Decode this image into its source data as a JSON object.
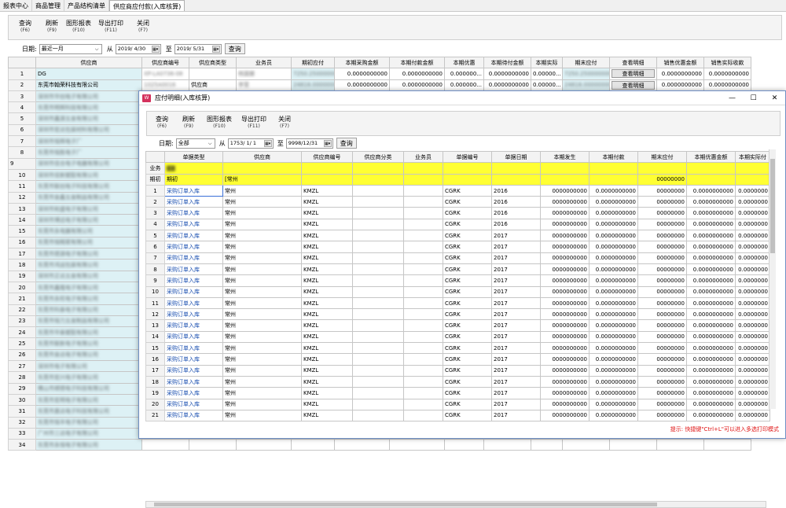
{
  "tabs": [
    "报表中心",
    "商品管理",
    "产品结构清单",
    "供应商应付款(入库核算)"
  ],
  "toolbar": [
    {
      "label": "查询",
      "key": "(F6)"
    },
    {
      "label": "刷新",
      "key": "(F9)"
    },
    {
      "label": "图形报表",
      "key": "(F10)"
    },
    {
      "label": "导出打印",
      "key": "(F11)"
    },
    {
      "label": "关闭",
      "key": "(F7)"
    }
  ],
  "filter": {
    "date_label": "日期:",
    "range_value": "最近一月",
    "from_label": "从",
    "from_date": "2019/ 4/30",
    "to_label": "至",
    "to_date": "2019/ 5/31",
    "query": "查询"
  },
  "main_grid": {
    "columns": [
      "供应商",
      "供应商编号",
      "供应商类型",
      "业务员",
      "期初应付",
      "本期采购金额",
      "本期付款金额",
      "本期优惠",
      "本期待付金额",
      "本期实际",
      "期末应付",
      "查看明细",
      "销售优惠金额",
      "销售实际收款"
    ],
    "detail_btn": "查看明细",
    "rows": [
      {
        "n": "1",
        "supplier": "DG",
        "code": "XP-LA0736-08",
        "type": "",
        "staff": "杨国娜",
        "open": "7250.2500000000",
        "purchase": "0.0000000000",
        "paid": "0.0000000000",
        "disc": "0.000000...",
        "due": "0.0000000000",
        "actual": "0.00000...",
        "close": "7250.2500000000",
        "sdisc": "0.0000000000",
        "srecv": "0.0000000000"
      },
      {
        "n": "2",
        "supplier": "东莞市翰荣科技有限公司",
        "code": "1025A0016",
        "type": "供应商",
        "staff": "李莹",
        "open": "24816.0000000000",
        "purchase": "0.0000000000",
        "paid": "0.0000000000",
        "disc": "0.000000...",
        "due": "0.0000000000",
        "actual": "0.00000...",
        "close": "24816.0000000000",
        "sdisc": "0.0000000000",
        "srecv": "0.0000000000"
      },
      {
        "n": "3",
        "supplier": "深圳市华创电子有限公司"
      },
      {
        "n": "4",
        "supplier": "东莞市明辉科技有限公司"
      },
      {
        "n": "5",
        "supplier": "深圳市鑫源五金有限公司"
      },
      {
        "n": "6",
        "supplier": "深圳市宏达包装材料有限公司"
      },
      {
        "n": "7",
        "supplier": "深圳市恒辉电子厂"
      },
      {
        "n": "8",
        "supplier": "东莞市恒胜电子厂"
      },
      {
        "n": "9",
        "supplier": "深圳市佳合电子电器有限公司"
      },
      {
        "n": "10",
        "supplier": "深圳市佳新塑胶有限公司"
      },
      {
        "n": "11",
        "supplier": "东莞市联创电子科技有限公司"
      },
      {
        "n": "12",
        "supplier": "东莞市金鑫五金制品有限公司"
      },
      {
        "n": "13",
        "supplier": "深圳市和盛电子有限公司"
      },
      {
        "n": "14",
        "supplier": "深圳市博远电子有限公司"
      },
      {
        "n": "15",
        "supplier": "东莞市永电器有限公司"
      },
      {
        "n": "16",
        "supplier": "东莞市恒精密有限公司"
      },
      {
        "n": "17",
        "supplier": "东莞市德源电子有限公司"
      },
      {
        "n": "18",
        "supplier": "东莞市鸿运包装有限公司"
      },
      {
        "n": "19",
        "supplier": "深圳市正达五金有限公司"
      },
      {
        "n": "20",
        "supplier": "东莞市鑫隆电子有限公司"
      },
      {
        "n": "21",
        "supplier": "东莞市永旺电子有限公司"
      },
      {
        "n": "22",
        "supplier": "东莞市科泰电子有限公司"
      },
      {
        "n": "23",
        "supplier": "东莞市恒力五金制品有限公司"
      },
      {
        "n": "24",
        "supplier": "东莞市华泰塑胶有限公司"
      },
      {
        "n": "25",
        "supplier": "东莞市联新电子有限公司"
      },
      {
        "n": "26",
        "supplier": "东莞市金达电子有限公司"
      },
      {
        "n": "27",
        "supplier": "深圳市电子有限公司"
      },
      {
        "n": "28",
        "supplier": "东莞市宏兴电子有限公司"
      },
      {
        "n": "29",
        "supplier": "佛山市顺德电子科技有限公司"
      },
      {
        "n": "30",
        "supplier": "东莞市宏明电子有限公司"
      },
      {
        "n": "31",
        "supplier": "东莞市嘉达电子科技有限公司"
      },
      {
        "n": "32",
        "supplier": "东莞市恒丰电子有限公司"
      },
      {
        "n": "33",
        "supplier": "广州市三达电子有限公司"
      },
      {
        "n": "34",
        "supplier": "东莞市永恒电子有限公司"
      }
    ]
  },
  "dialog": {
    "title": "应付明细(入库核算)",
    "window_controls": [
      "—",
      "☐",
      "✕"
    ],
    "toolbar": [
      {
        "label": "查询",
        "key": "(F6)"
      },
      {
        "label": "刷新",
        "key": "(F9)"
      },
      {
        "label": "图形报表",
        "key": "(F10)"
      },
      {
        "label": "导出打印",
        "key": "(F11)"
      },
      {
        "label": "关闭",
        "key": "(F7)"
      }
    ],
    "filter": {
      "date_label": "日期:",
      "range_value": "全部",
      "from_label": "从",
      "from_date": "1753/ 1/ 1",
      "to_label": "至",
      "to_date": "9998/12/31",
      "query": "查询"
    },
    "columns": [
      "单据类型",
      "供应商",
      "供应商编号",
      "供应商分类",
      "业务员",
      "单据编号",
      "单据日期",
      "本期发生",
      "本期付款",
      "期末应付",
      "本期优惠金额",
      "本期实际付"
    ],
    "summary": {
      "row1_label": "业务",
      "row2_label": "期初",
      "row2_type": "期初",
      "row2_supplier": "[常州",
      "row2_close": "00000000"
    },
    "rows": [
      {
        "n": "1",
        "type": "采购订单入库",
        "supplier": "常州",
        "code": "KMZL",
        "bill": "CGRK",
        "date": "2016",
        "amount": "0000000000",
        "paid": "0.0000000000",
        "close": "00000000",
        "disc": "0.0000000000",
        "actual": "0.0000000"
      },
      {
        "n": "2",
        "type": "采购订单入库",
        "supplier": "常州",
        "code": "KMZL",
        "bill": "CGRK",
        "date": "2016",
        "amount": "0000000000",
        "paid": "0.0000000000",
        "close": "00000000",
        "disc": "0.0000000000",
        "actual": "0.0000000"
      },
      {
        "n": "3",
        "type": "采购订单入库",
        "supplier": "常州",
        "code": "KMZL",
        "bill": "CGRK",
        "date": "2016",
        "amount": "0000000000",
        "paid": "0.0000000000",
        "close": "00000000",
        "disc": "0.0000000000",
        "actual": "0.0000000"
      },
      {
        "n": "4",
        "type": "采购订单入库",
        "supplier": "常州",
        "code": "KMZL",
        "bill": "CGRK",
        "date": "2016",
        "amount": "0000000000",
        "paid": "0.0000000000",
        "close": "00000000",
        "disc": "0.0000000000",
        "actual": "0.0000000"
      },
      {
        "n": "5",
        "type": "采购订单入库",
        "supplier": "常州",
        "code": "KMZL",
        "bill": "CGRK",
        "date": "2017",
        "amount": "0000000000",
        "paid": "0.0000000000",
        "close": "00000000",
        "disc": "0.0000000000",
        "actual": "0.0000000"
      },
      {
        "n": "6",
        "type": "采购订单入库",
        "supplier": "常州",
        "code": "KMZL",
        "bill": "CGRK",
        "date": "2017",
        "amount": "0000000000",
        "paid": "0.0000000000",
        "close": "00000000",
        "disc": "0.0000000000",
        "actual": "0.0000000"
      },
      {
        "n": "7",
        "type": "采购订单入库",
        "supplier": "常州",
        "code": "KMZL",
        "bill": "CGRK",
        "date": "2017",
        "amount": "0000000000",
        "paid": "0.0000000000",
        "close": "00000000",
        "disc": "0.0000000000",
        "actual": "0.0000000"
      },
      {
        "n": "8",
        "type": "采购订单入库",
        "supplier": "常州",
        "code": "KMZL",
        "bill": "CGRK",
        "date": "2017",
        "amount": "0000000000",
        "paid": "0.0000000000",
        "close": "00000000",
        "disc": "0.0000000000",
        "actual": "0.0000000"
      },
      {
        "n": "9",
        "type": "采购订单入库",
        "supplier": "常州",
        "code": "KMZL",
        "bill": "CGRK",
        "date": "2017",
        "amount": "0000000000",
        "paid": "0.0000000000",
        "close": "00000000",
        "disc": "0.0000000000",
        "actual": "0.0000000"
      },
      {
        "n": "10",
        "type": "采购订单入库",
        "supplier": "常州",
        "code": "KMZL",
        "bill": "CGRK",
        "date": "2017",
        "amount": "0000000000",
        "paid": "0.0000000000",
        "close": "00000000",
        "disc": "0.0000000000",
        "actual": "0.0000000"
      },
      {
        "n": "11",
        "type": "采购订单入库",
        "supplier": "常州",
        "code": "KMZL",
        "bill": "CGRK",
        "date": "2017",
        "amount": "0000000000",
        "paid": "0.0000000000",
        "close": "00000000",
        "disc": "0.0000000000",
        "actual": "0.0000000"
      },
      {
        "n": "12",
        "type": "采购订单入库",
        "supplier": "常州",
        "code": "KMZL",
        "bill": "CGRK",
        "date": "2017",
        "amount": "0000000000",
        "paid": "0.0000000000",
        "close": "00000000",
        "disc": "0.0000000000",
        "actual": "0.0000000"
      },
      {
        "n": "13",
        "type": "采购订单入库",
        "supplier": "常州",
        "code": "KMZL",
        "bill": "CGRK",
        "date": "2017",
        "amount": "0000000000",
        "paid": "0.0000000000",
        "close": "00000000",
        "disc": "0.0000000000",
        "actual": "0.0000000"
      },
      {
        "n": "14",
        "type": "采购订单入库",
        "supplier": "常州",
        "code": "KMZL",
        "bill": "CGRK",
        "date": "2017",
        "amount": "0000000000",
        "paid": "0.0000000000",
        "close": "00000000",
        "disc": "0.0000000000",
        "actual": "0.0000000"
      },
      {
        "n": "15",
        "type": "采购订单入库",
        "supplier": "常州",
        "code": "KMZL",
        "bill": "CGRK",
        "date": "2017",
        "amount": "0000000000",
        "paid": "0.0000000000",
        "close": "00000000",
        "disc": "0.0000000000",
        "actual": "0.0000000"
      },
      {
        "n": "16",
        "type": "采购订单入库",
        "supplier": "常州",
        "code": "KMZL",
        "bill": "CGRK",
        "date": "2017",
        "amount": "0000000000",
        "paid": "0.0000000000",
        "close": "00000000",
        "disc": "0.0000000000",
        "actual": "0.0000000"
      },
      {
        "n": "17",
        "type": "采购订单入库",
        "supplier": "常州",
        "code": "KMZL",
        "bill": "CGRK",
        "date": "2017",
        "amount": "0000000000",
        "paid": "0.0000000000",
        "close": "00000000",
        "disc": "0.0000000000",
        "actual": "0.0000000"
      },
      {
        "n": "18",
        "type": "采购订单入库",
        "supplier": "常州",
        "code": "KMZL",
        "bill": "CGRK",
        "date": "2017",
        "amount": "0000000000",
        "paid": "0.0000000000",
        "close": "00000000",
        "disc": "0.0000000000",
        "actual": "0.0000000"
      },
      {
        "n": "19",
        "type": "采购订单入库",
        "supplier": "常州",
        "code": "KMZL",
        "bill": "CGRK",
        "date": "2017",
        "amount": "0000000000",
        "paid": "0.0000000000",
        "close": "00000000",
        "disc": "0.0000000000",
        "actual": "0.0000000"
      },
      {
        "n": "20",
        "type": "采购订单入库",
        "supplier": "常州",
        "code": "KMZL",
        "bill": "CGRK",
        "date": "2017",
        "amount": "0000000000",
        "paid": "0.0000000000",
        "close": "00000000",
        "disc": "0.0000000000",
        "actual": "0.0000000"
      },
      {
        "n": "21",
        "type": "采购订单入库",
        "supplier": "常州",
        "code": "KMZL",
        "bill": "CGRK",
        "date": "2017",
        "amount": "0000000000",
        "paid": "0.0000000000",
        "close": "00000000",
        "disc": "0.0000000000",
        "actual": "0.0000000"
      }
    ],
    "hint": "提示: 快捷键\"Ctrl+L\"可以进入多选打印模式"
  }
}
